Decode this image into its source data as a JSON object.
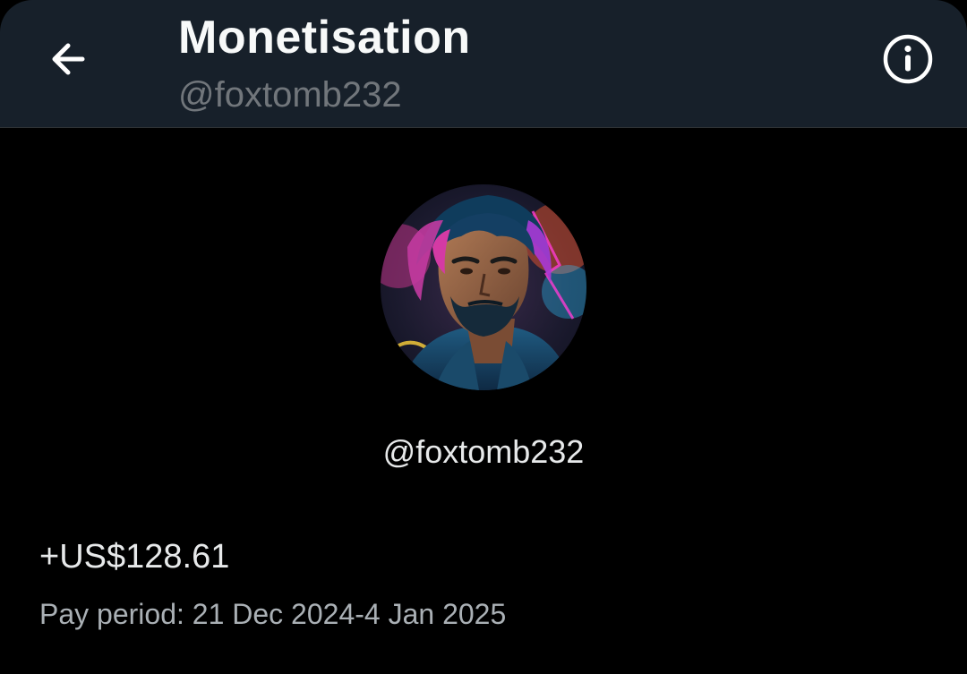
{
  "header": {
    "title": "Monetisation",
    "subtitle": "@foxtomb232",
    "back_icon": "arrow-left-icon",
    "info_icon": "info-circle-icon"
  },
  "profile": {
    "avatar_icon": "profile-avatar",
    "handle": "@foxtomb232"
  },
  "earnings": {
    "amount": "+US$128.61",
    "pay_period": "Pay period: 21 Dec 2024-4 Jan 2025"
  },
  "colors": {
    "background": "#000000",
    "header_background": "#17202a",
    "primary_text": "#e7e9ea",
    "secondary_text": "#71767b"
  }
}
